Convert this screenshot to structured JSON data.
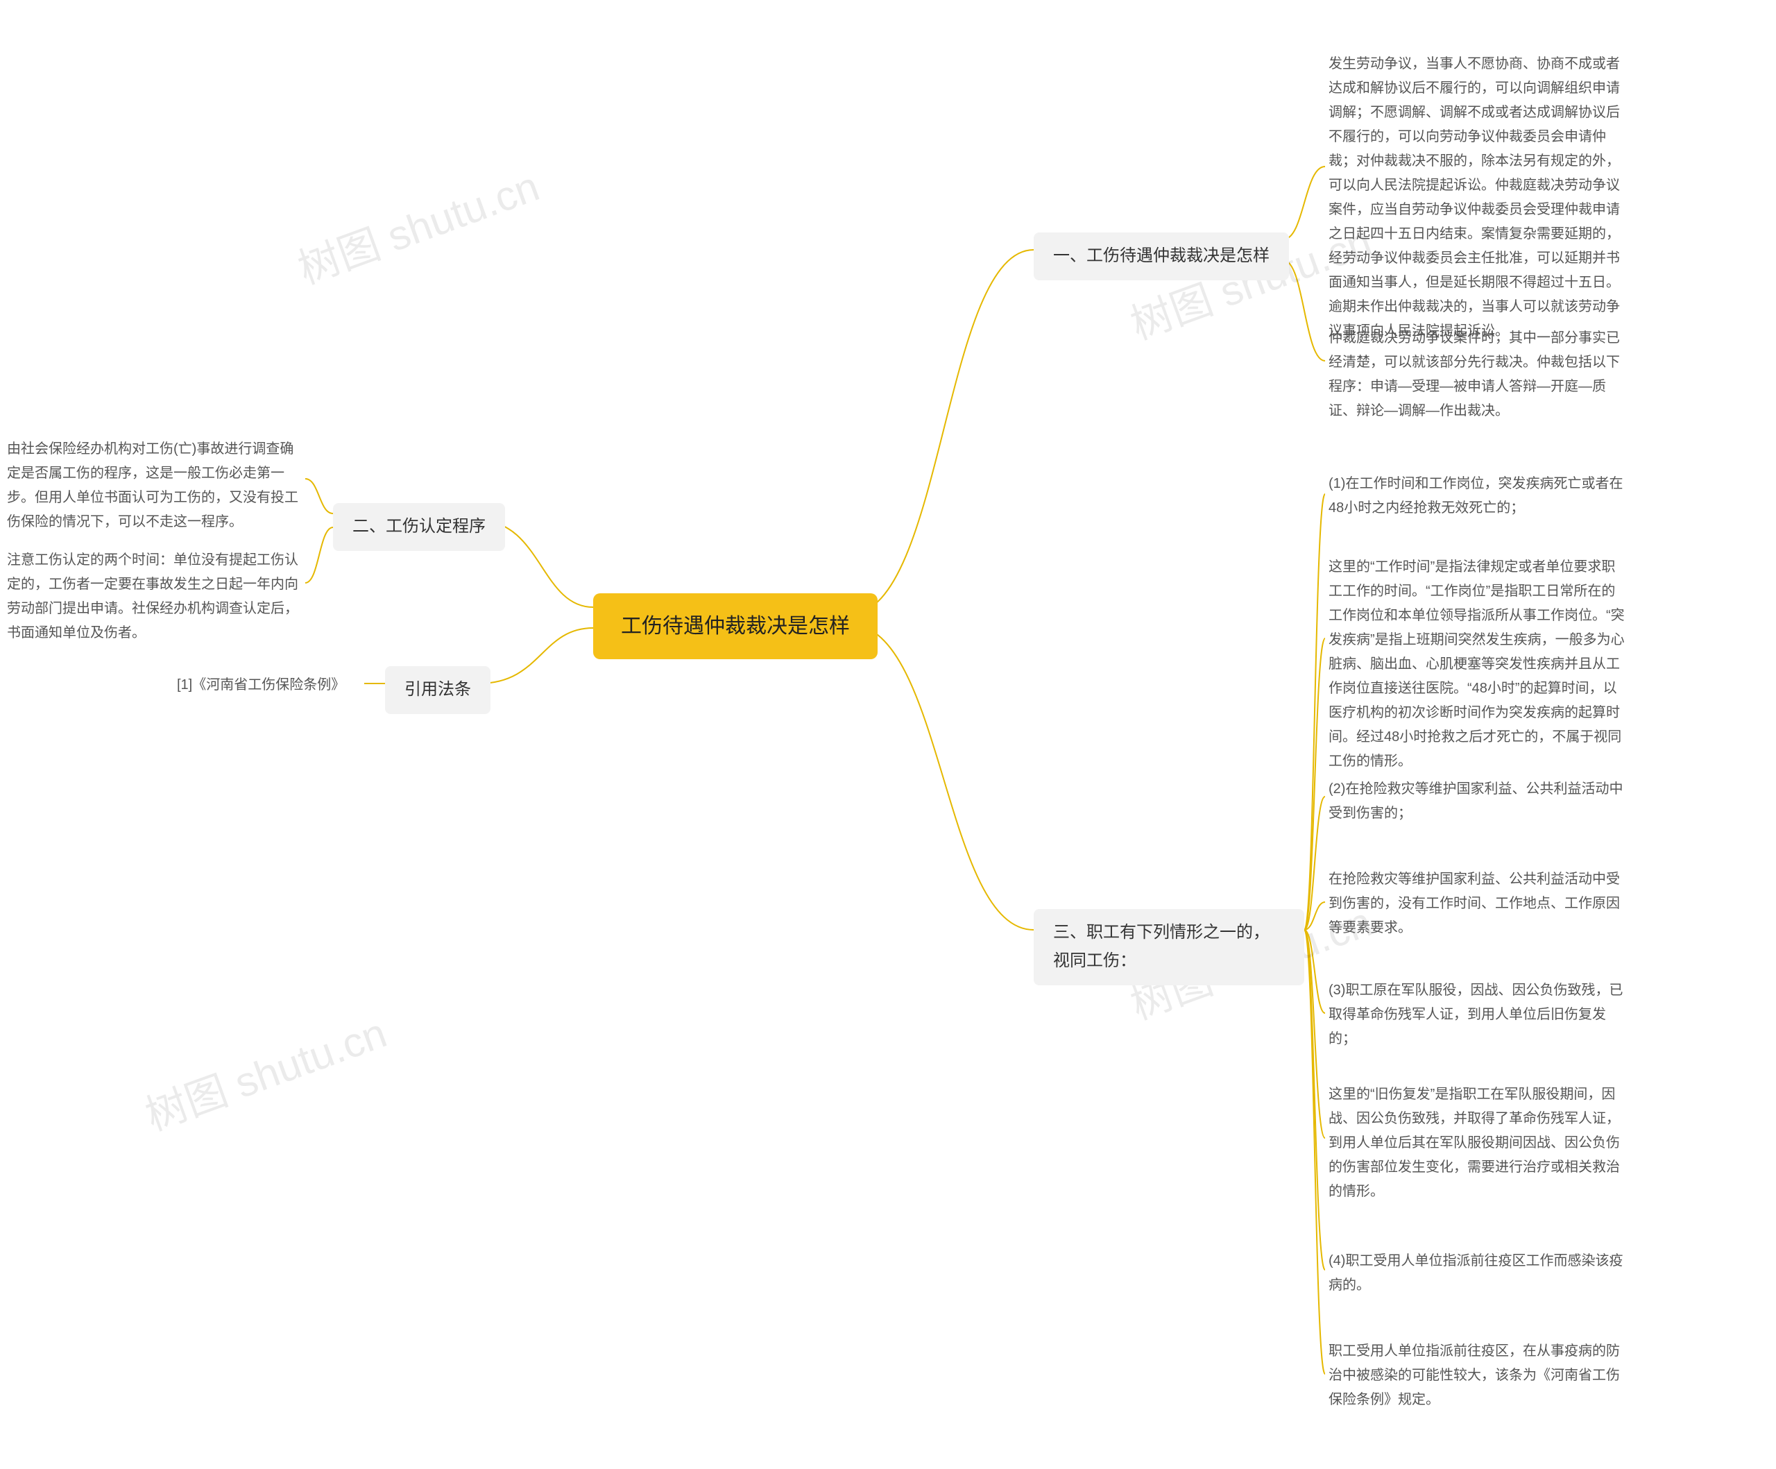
{
  "watermark_text": "树图 shutu.cn",
  "root": {
    "title": "工伤待遇仲裁裁决是怎样"
  },
  "branches": {
    "b1": {
      "title": "一、工伤待遇仲裁裁决是怎样"
    },
    "b2": {
      "title": "二、工伤认定程序"
    },
    "b3": {
      "title": "三、职工有下列情形之一的，视同工伤："
    },
    "b4": {
      "title": "引用法条"
    }
  },
  "leaves": {
    "b1_l1": "发生劳动争议，当事人不愿协商、协商不成或者达成和解协议后不履行的，可以向调解组织申请调解；不愿调解、调解不成或者达成调解协议后不履行的，可以向劳动争议仲裁委员会申请仲裁；对仲裁裁决不服的，除本法另有规定的外，可以向人民法院提起诉讼。仲裁庭裁决劳动争议案件，应当自劳动争议仲裁委员会受理仲裁申请之日起四十五日内结束。案情复杂需要延期的，经劳动争议仲裁委员会主任批准，可以延期并书面通知当事人，但是延长期限不得超过十五日。逾期未作出仲裁裁决的，当事人可以就该劳动争议事项向人民法院提起诉讼。",
    "b1_l2": "仲裁庭裁决劳动争议案件时，其中一部分事实已经清楚，可以就该部分先行裁决。仲裁包括以下程序：申请—受理—被申请人答辩—开庭—质证、辩论—调解—作出裁决。",
    "b2_l1": "由社会保险经办机构对工伤(亡)事故进行调查确定是否属工伤的程序，这是一般工伤必走第一步。但用人单位书面认可为工伤的，又没有投工伤保险的情况下，可以不走这一程序。",
    "b2_l2": "注意工伤认定的两个时间：单位没有提起工伤认定的，工伤者一定要在事故发生之日起一年内向劳动部门提出申请。社保经办机构调查认定后，书面通知单位及伤者。",
    "b3_l1": "(1)在工作时间和工作岗位，突发疾病死亡或者在48小时之内经抢救无效死亡的；",
    "b3_l2": "这里的“工作时间”是指法律规定或者单位要求职工工作的时间。“工作岗位”是指职工日常所在的工作岗位和本单位领导指派所从事工作岗位。“突发疾病”是指上班期间突然发生疾病，一般多为心脏病、脑出血、心肌梗塞等突发性疾病并且从工作岗位直接送往医院。“48小时”的起算时间，以医疗机构的初次诊断时间作为突发疾病的起算时间。经过48小时抢救之后才死亡的，不属于视同工伤的情形。",
    "b3_l3": "(2)在抢险救灾等维护国家利益、公共利益活动中受到伤害的；",
    "b3_l4": "在抢险救灾等维护国家利益、公共利益活动中受到伤害的，没有工作时间、工作地点、工作原因等要素要求。",
    "b3_l5": "(3)职工原在军队服役，因战、因公负伤致残，已取得革命伤残军人证，到用人单位后旧伤复发的；",
    "b3_l6": "这里的“旧伤复发”是指职工在军队服役期间，因战、因公负伤致残，并取得了革命伤残军人证，到用人单位后其在军队服役期间因战、因公负伤的伤害部位发生变化，需要进行治疗或相关救治的情形。",
    "b3_l7": "(4)职工受用人单位指派前往疫区工作而感染该疫病的。",
    "b3_l8": "职工受用人单位指派前往疫区，在从事疫病的防治中被感染的可能性较大，该条为《河南省工伤保险条例》规定。",
    "b4_l1": "[1]《河南省工伤保险条例》"
  }
}
